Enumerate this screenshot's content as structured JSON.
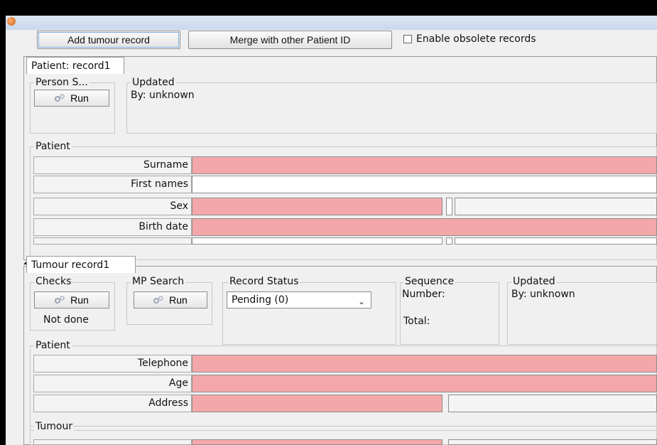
{
  "toolbar": {
    "add_tumour_record": "Add tumour record",
    "merge_patient": "Merge with other Patient ID",
    "enable_obsolete": "Enable obsolete records"
  },
  "patient_tab": {
    "label": "Patient:  record1",
    "person_search_title": "Person S...",
    "run_label": "Run",
    "updated_title": "Updated",
    "updated_by": "By:  unknown",
    "group_title": "Patient",
    "rows": [
      "Surname",
      "First names",
      "Sex",
      "Birth date"
    ]
  },
  "tumour_tab": {
    "label": "Tumour  record1",
    "checks_title": "Checks",
    "checks_run": "Run",
    "checks_status": "Not done",
    "mp_search_title": "MP Search",
    "mp_run": "Run",
    "record_status_title": "Record Status",
    "record_status_value": "Pending (0)",
    "sequence_title": "Sequence",
    "sequence_number": "Number:",
    "sequence_total": "Total:",
    "updated_title": "Updated",
    "updated_by": "By:  unknown",
    "patient_group_title": "Patient",
    "patient_rows": [
      "Telephone",
      "Age",
      "Address"
    ],
    "tumour_group_title": "Tumour"
  },
  "colors": {
    "required_field": "#f4a7a9",
    "background": "#f0f0f0"
  }
}
